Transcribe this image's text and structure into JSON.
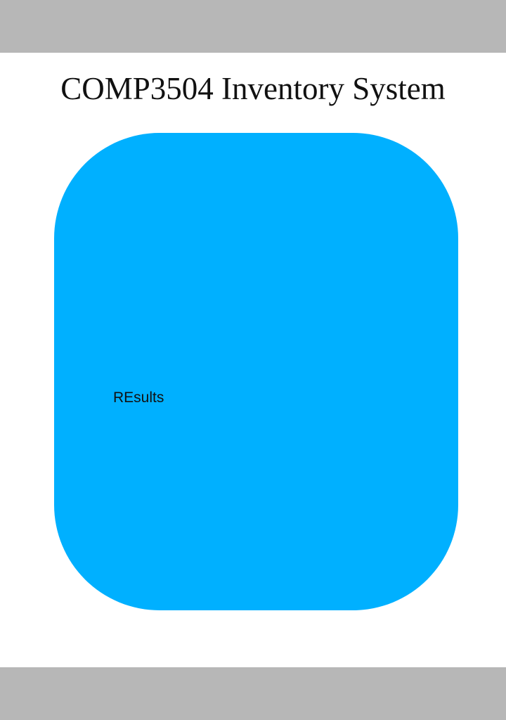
{
  "header": {
    "title": "COMP3504 Inventory System"
  },
  "results": {
    "label": "REsults"
  },
  "colors": {
    "bar": "#b7b7b7",
    "panel": "#00b0ff",
    "background": "#ffffff",
    "text": "#111111"
  }
}
